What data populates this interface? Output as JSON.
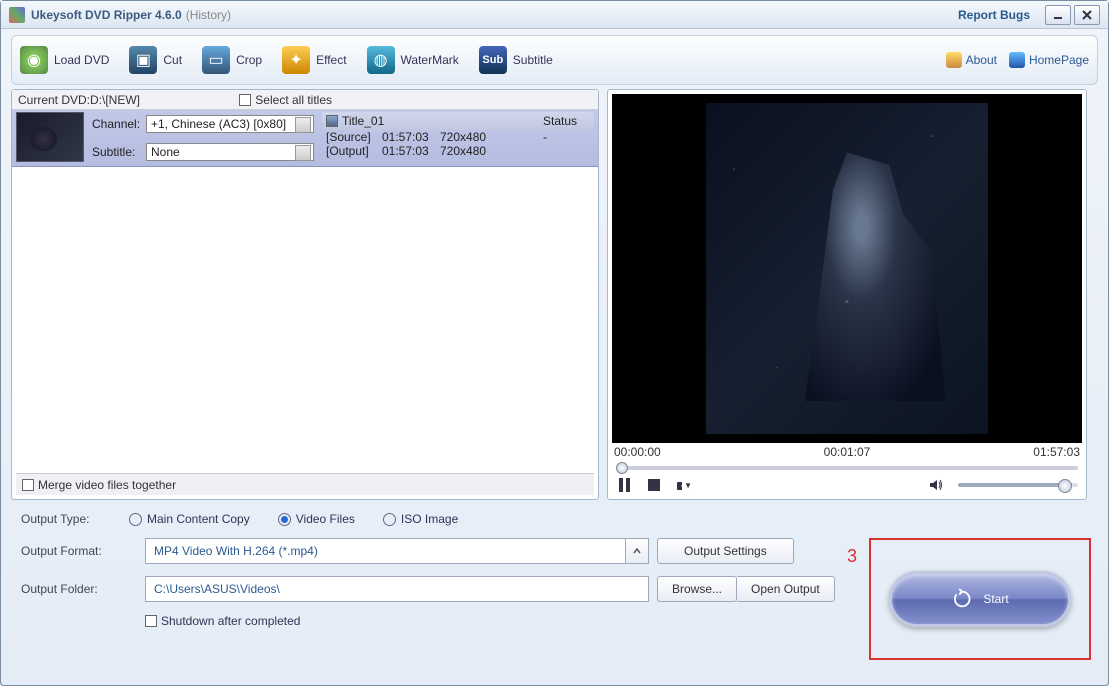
{
  "title": {
    "app": "Ukeysoft DVD Ripper 4.6.0",
    "history": "(History)",
    "report": "Report Bugs"
  },
  "toolbar": {
    "load_dvd": "Load DVD",
    "cut": "Cut",
    "crop": "Crop",
    "effect": "Effect",
    "watermark": "WaterMark",
    "subtitle": "Subtitle",
    "about": "About",
    "homepage": "HomePage"
  },
  "dvd": {
    "current_label": "Current DVD:D:\\[NEW]",
    "select_all": "Select all titles",
    "channel_label": "Channel:",
    "channel_value": "+1, Chinese (AC3) [0x80]",
    "subtitle_label": "Subtitle:",
    "subtitle_value": "None",
    "title_name": "Title_01",
    "status_label": "Status",
    "source_label": "[Source]",
    "output_label": "[Output]",
    "source_dur": "01:57:03",
    "source_res": "720x480",
    "output_dur": "01:57:03",
    "output_res": "720x480",
    "status_val": "-",
    "merge": "Merge video files together"
  },
  "player": {
    "t_start": "00:00:00",
    "t_current": "00:01:07",
    "t_end": "01:57:03"
  },
  "output": {
    "type_label": "Output Type:",
    "radios": {
      "main": "Main Content Copy",
      "video": "Video Files",
      "iso": "ISO Image"
    },
    "format_label": "Output Format:",
    "format_value": "MP4 Video With H.264 (*.mp4)",
    "output_settings": "Output Settings",
    "folder_label": "Output Folder:",
    "folder_value": "C:\\Users\\ASUS\\Videos\\",
    "browse": "Browse...",
    "open_output": "Open Output",
    "shutdown": "Shutdown after completed"
  },
  "start": {
    "num": "3",
    "label": "Start"
  }
}
